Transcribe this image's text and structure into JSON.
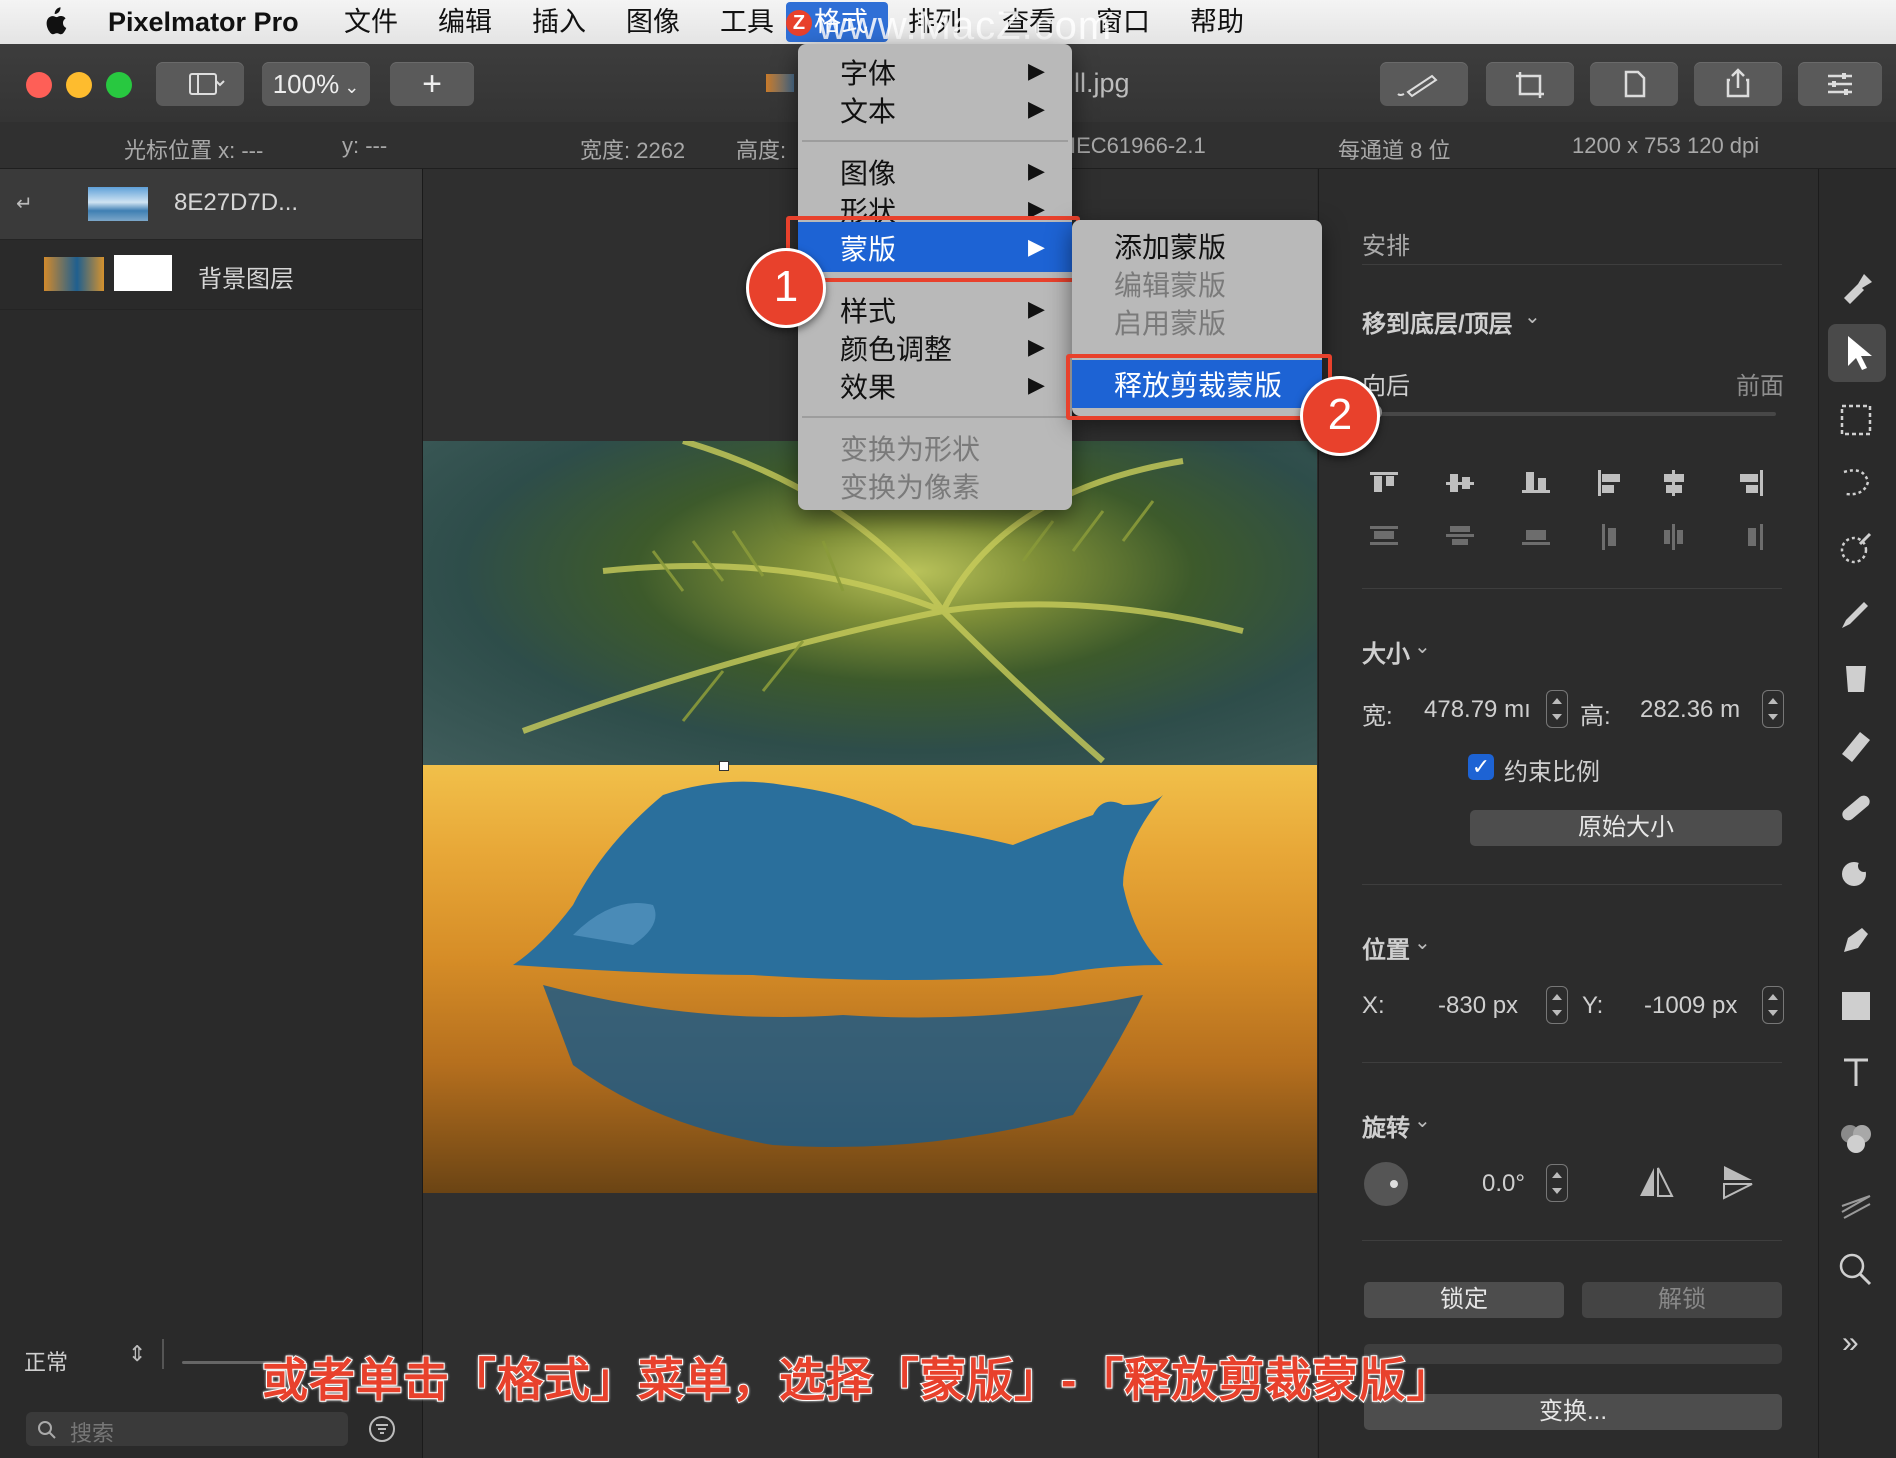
{
  "menubar": {
    "app_name": "Pixelmator Pro",
    "items": [
      "文件",
      "编辑",
      "插入",
      "图像",
      "工具",
      "格式",
      "排列",
      "查看",
      "窗口",
      "帮助"
    ],
    "watermark": "www.MacZ.com",
    "watermark_logo": "Z"
  },
  "toolbar": {
    "zoom": "100%",
    "add": "+",
    "doc_title": "ll.jpg"
  },
  "infobar": {
    "cursor_x": "光标位置 x:  ---",
    "cursor_y": "y:  ---",
    "width": "宽度:  2262",
    "height": "高度:",
    "profile": "IEC61966-2.1",
    "depth": "每通道 8 位",
    "resolution": "1200 x 753 120 dpi"
  },
  "layers": {
    "items": [
      {
        "name": "8E27D7D..."
      },
      {
        "name": "背景图层"
      }
    ],
    "blend_mode": "正常",
    "search_placeholder": "搜索"
  },
  "format_menu": {
    "items": [
      "字体",
      "文本",
      "图像",
      "形状",
      "蒙版",
      "样式",
      "颜色调整",
      "效果",
      "变换为形状",
      "变换为像素"
    ],
    "arrow": "▶"
  },
  "mask_submenu": {
    "items": [
      "添加蒙版",
      "编辑蒙版",
      "启用蒙版",
      "释放剪裁蒙版"
    ]
  },
  "steps": [
    "1",
    "2"
  ],
  "inspector": {
    "arrange_title": "安排",
    "move_title": "移到底层/顶层",
    "back": "向后",
    "front": "前面",
    "size_title": "大小",
    "width_label": "宽:",
    "width_value": "478.79 mı",
    "height_label": "高:",
    "height_value": "282.36 m",
    "constrain": "约束比例",
    "original_size": "原始大小",
    "position_title": "位置",
    "x_label": "X:",
    "x_value": "-830 px",
    "y_label": "Y:",
    "y_value": "-1009 px",
    "rotate_title": "旋转",
    "rotate_value": "0.0°",
    "lock": "锁定",
    "unlock": "解锁",
    "transform": "变换..."
  },
  "caption": "或者单击「格式」菜单，选择「蒙版」-「释放剪裁蒙版」",
  "colors": {
    "accent": "#1d63d4",
    "annotation": "#e8412c"
  }
}
